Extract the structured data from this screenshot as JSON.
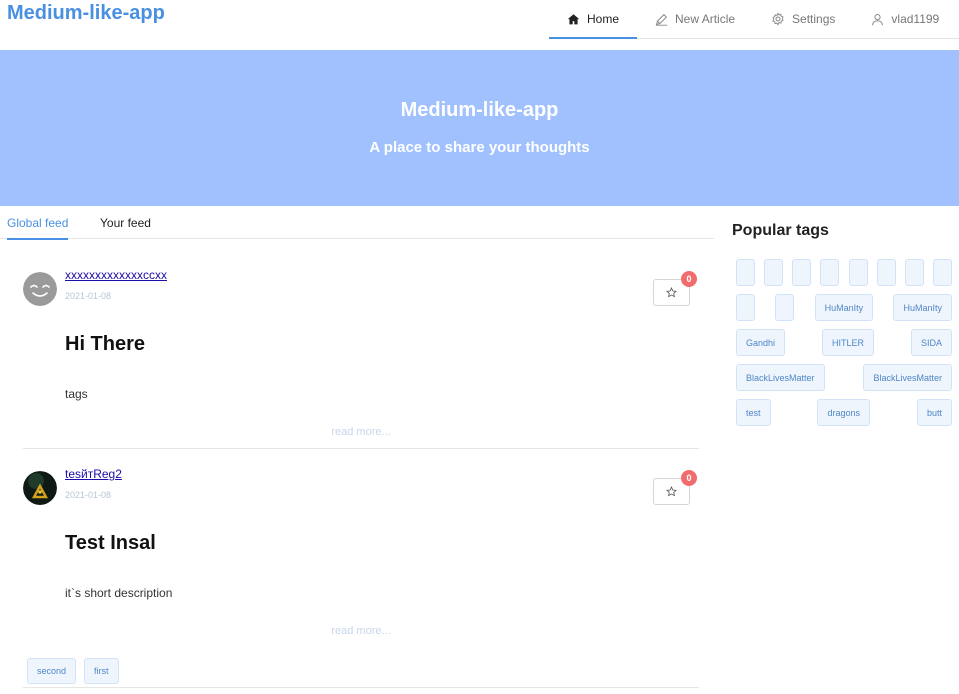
{
  "header": {
    "brand": "Medium-like-app",
    "nav": [
      {
        "label": "Home",
        "icon": "home-icon",
        "active": true
      },
      {
        "label": "New Article",
        "icon": "pencil-icon",
        "active": false
      },
      {
        "label": "Settings",
        "icon": "gear-icon",
        "active": false
      },
      {
        "label": "vlad1199",
        "icon": "user-icon",
        "active": false
      }
    ]
  },
  "banner": {
    "title": "Medium-like-app",
    "subtitle": "A place to share your thoughts"
  },
  "feed_tabs": {
    "global": "Global feed",
    "your": "Your feed"
  },
  "articles": [
    {
      "author": "xxxxxxxxxxxxxccxx",
      "date": "2021-01-08",
      "favorites": "0",
      "title": "Hi There",
      "description": "tags",
      "read_more": "read more...",
      "tags": []
    },
    {
      "author": "tesйтReg2",
      "date": "2021-01-08",
      "favorites": "0",
      "title": "Test Insal",
      "description": "it`s short description",
      "read_more": "read more...",
      "tags": [
        "second",
        "first"
      ]
    }
  ],
  "sidebar": {
    "title": "Popular tags",
    "tag_rows": [
      [
        "",
        "",
        "",
        "",
        "",
        "",
        "",
        ""
      ],
      [
        "",
        "",
        "HuManIty",
        "HuManIty"
      ],
      [
        "Gandhi",
        "HITLER",
        "SIDA"
      ],
      [
        "BlackLivesMatter",
        "BlackLivesMatter"
      ],
      [
        "test",
        "dragons",
        "butt"
      ]
    ]
  },
  "colors": {
    "accent": "#4a90e2",
    "banner": "#a0c1fd",
    "badge": "#f16d6d"
  }
}
